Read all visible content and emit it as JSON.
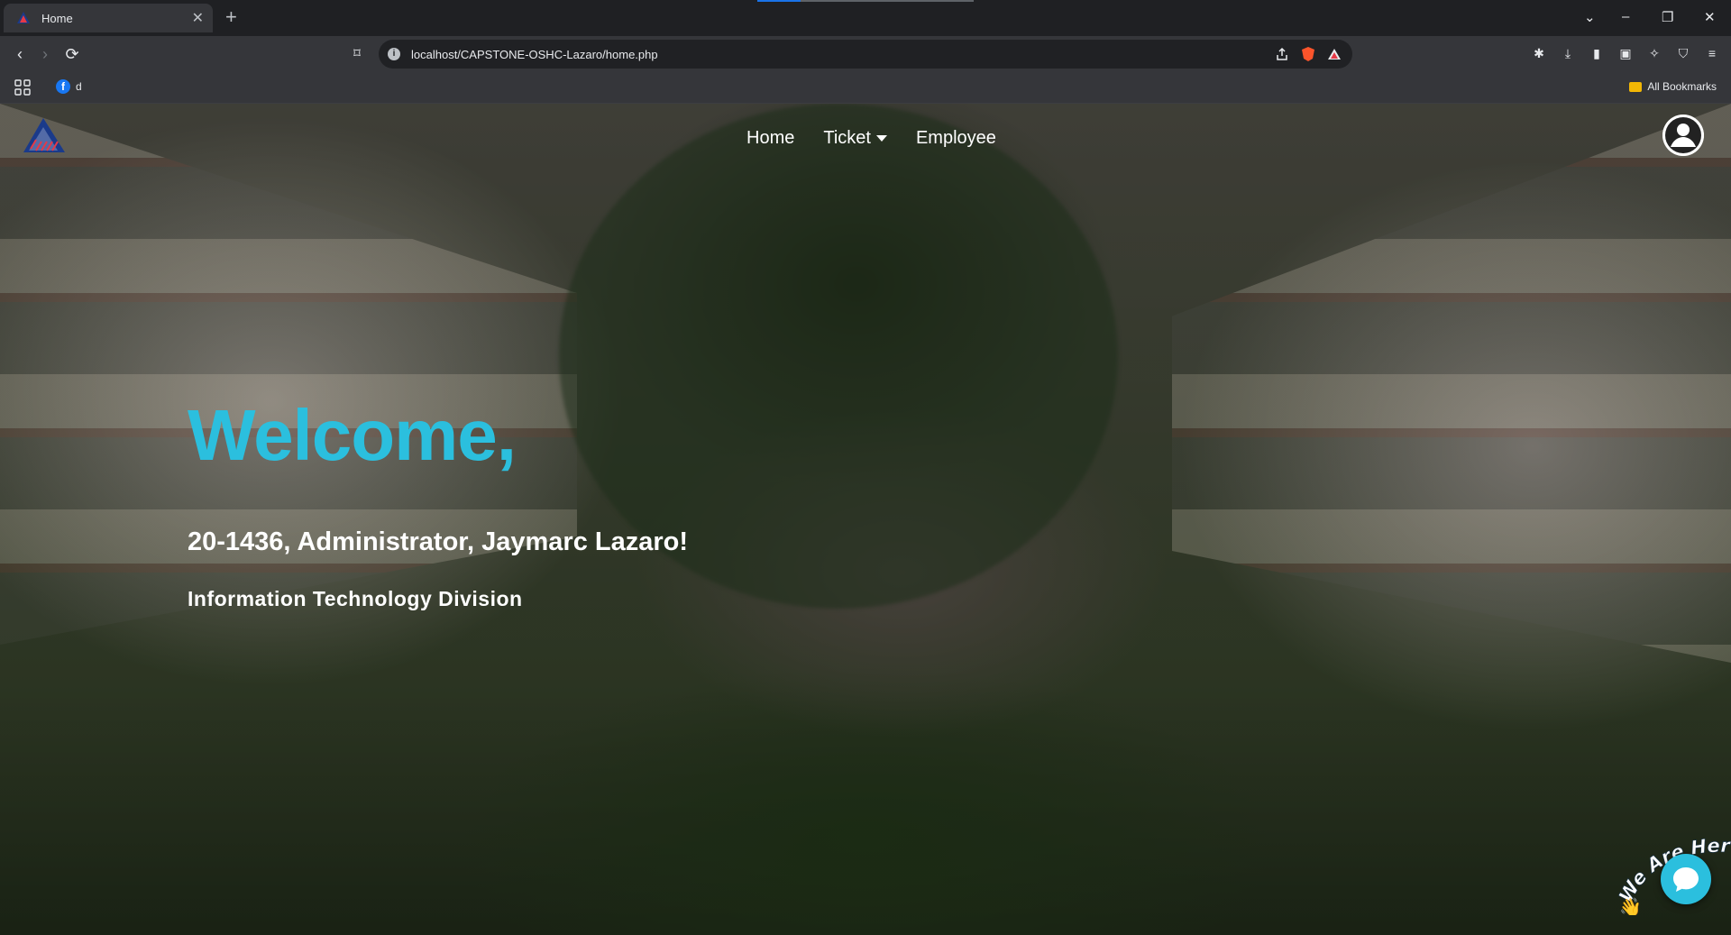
{
  "browser": {
    "tab_title": "Home",
    "tab_close": "✕",
    "new_tab": "+",
    "url": "localhost/CAPSTONE-OSHC-Lazaro/home.php",
    "bookmarks": [
      {
        "label": "d"
      }
    ],
    "all_bookmarks": "All Bookmarks",
    "window_controls": [
      "⌄",
      "–",
      "❐",
      "✕"
    ]
  },
  "site": {
    "nav": {
      "home": "Home",
      "ticket": "Ticket",
      "employee": "Employee"
    },
    "welcome": "Welcome,",
    "greeting": "20-1436, Administrator, Jaymarc Lazaro!",
    "division": "Information Technology Division",
    "chat_widget_label": "We Are Here!",
    "colors": {
      "accent": "#2bbfde",
      "text": "#ffffff"
    }
  }
}
